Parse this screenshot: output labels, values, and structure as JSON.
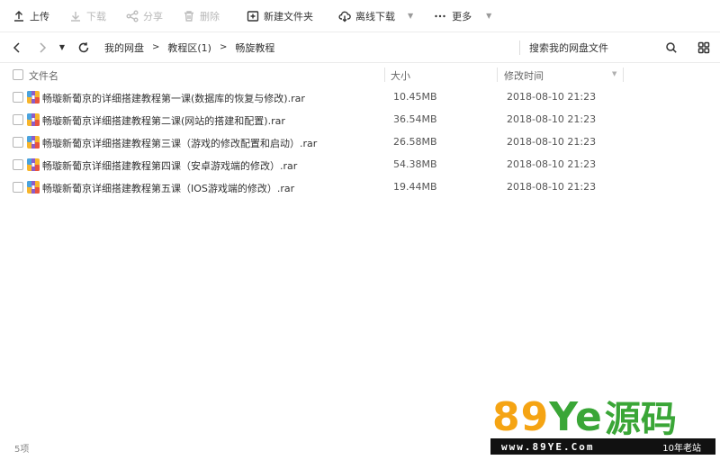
{
  "toolbar": {
    "upload": "上传",
    "download": "下载",
    "share": "分享",
    "delete": "删除",
    "new_folder": "新建文件夹",
    "offline_download": "离线下载",
    "more": "更多"
  },
  "breadcrumb": [
    "我的网盘",
    "教程区(1)",
    "畅旋教程"
  ],
  "breadcrumb_sep": ">",
  "search": {
    "placeholder": "搜索我的网盘文件"
  },
  "columns": {
    "name": "文件名",
    "size": "大小",
    "modified": "修改时间"
  },
  "files": [
    {
      "name": "畅璇新葡京的详细搭建教程第一课(数据库的恢复与修改).rar",
      "size": "10.45MB",
      "modified": "2018-08-10 21:23"
    },
    {
      "name": "畅璇新葡京详细搭建教程第二课(网站的搭建和配置).rar",
      "size": "36.54MB",
      "modified": "2018-08-10 21:23"
    },
    {
      "name": "畅璇新葡京详细搭建教程第三课（游戏的修改配置和启动）.rar",
      "size": "26.58MB",
      "modified": "2018-08-10 21:23"
    },
    {
      "name": "畅璇新葡京详细搭建教程第四课（安卓游戏端的修改）.rar",
      "size": "54.38MB",
      "modified": "2018-08-10 21:23"
    },
    {
      "name": "畅璇新葡京详细搭建教程第五课（IOS游戏端的修改）.rar",
      "size": "19.44MB",
      "modified": "2018-08-10 21:23"
    }
  ],
  "status": {
    "count": "5项"
  },
  "watermark": {
    "big_num": "89",
    "big_ye": "Ye",
    "big_cn": "源码",
    "url": "www.89YE.Com",
    "tag": "10年老站"
  },
  "colors": {
    "watermark_orange": "#f5a413",
    "watermark_green": "#3aa637"
  }
}
